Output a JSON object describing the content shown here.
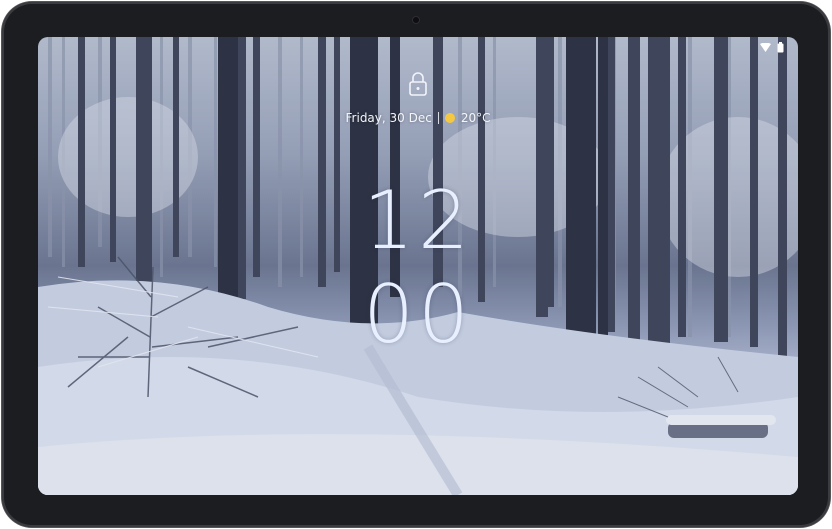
{
  "lockscreen": {
    "date": "Friday, 30 Dec",
    "temperature": "20°C",
    "weather_icon": "sun-icon",
    "clock_hours": "12",
    "clock_minutes": "00"
  },
  "status_bar": {
    "icons": [
      "wifi-icon",
      "battery-icon"
    ]
  },
  "colors": {
    "bezel": "#1c1d21",
    "clock_text": "#e8efff",
    "sun": "#f5c842"
  }
}
